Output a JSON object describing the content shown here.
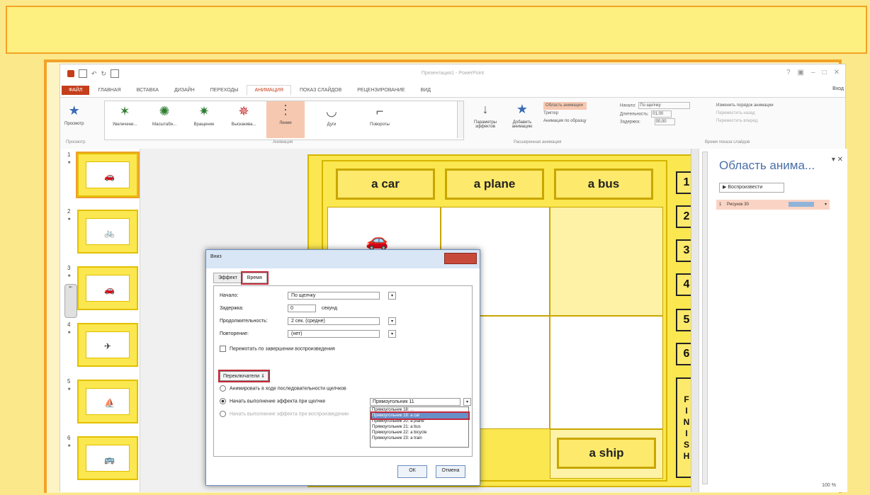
{
  "app": {
    "doc_title": "Презентация1 - PowerPoint",
    "user": "Вход"
  },
  "tabs": [
    "ФАЙЛ",
    "ГЛАВНАЯ",
    "ВСТАВКА",
    "ДИЗАЙН",
    "ПЕРЕХОДЫ",
    "АНИМАЦИЯ",
    "ПОКАЗ СЛАЙДОВ",
    "РЕЦЕНЗИРОВАНИЕ",
    "ВИД"
  ],
  "ribbon": {
    "preview_label": "Просмотр",
    "preview_group": "Просмотр",
    "animation_group": "Анимация",
    "animations": [
      {
        "label": "Увеличени..."
      },
      {
        "label": "Масштаби..."
      },
      {
        "label": "Вращение"
      },
      {
        "label": "Выскакива..."
      },
      {
        "label": "Линии"
      },
      {
        "label": "Дуги"
      },
      {
        "label": "Повороты"
      }
    ],
    "effect_params_label": "Параметры эффектов",
    "add_animation_label": "Добавить анимацию",
    "anim_pane_btn": "Область анимации",
    "trigger_btn": "Триггер",
    "anim_painter_btn": "Анимация по образцу",
    "ext_group": "Расширенная анимация",
    "start_label": "Начало:",
    "start_value": "По щелчку",
    "duration_label": "Длительность:",
    "duration_value": "01,00",
    "delay_label": "Задержка:",
    "delay_value": "00,00",
    "timing_group": "Время показа слайдов",
    "reorder_label": "Изменить порядок анимации",
    "move_earlier": "Переместить назад",
    "move_later": "Переместить вперед"
  },
  "thumbnails": [
    {
      "num": "1",
      "glyph": "🚗",
      "selected": true
    },
    {
      "num": "2",
      "glyph": "🚲",
      "selected": false
    },
    {
      "num": "3",
      "glyph": "🚗",
      "selected": false
    },
    {
      "num": "4",
      "glyph": "✈",
      "selected": false
    },
    {
      "num": "5",
      "glyph": "⛵",
      "selected": false
    },
    {
      "num": "6",
      "glyph": "🚌",
      "selected": false
    }
  ],
  "slide": {
    "labels": [
      "a car",
      "a plane",
      "a bus"
    ],
    "bottom_label": "a ship",
    "numbers": [
      "1",
      "2",
      "3",
      "4",
      "5",
      "6"
    ],
    "finish_letters": [
      "F",
      "I",
      "N",
      "I",
      "S",
      "H"
    ]
  },
  "anim_pane": {
    "title": "Область анима...",
    "play_btn": "Воспроизвести",
    "row_num": "1",
    "row_label": "Рисунок 30"
  },
  "dialog": {
    "title": "Вниз",
    "tab_effect": "Эффект",
    "tab_time": "Время",
    "start_label": "Начало:",
    "start_value": "По щелчку",
    "delay_label": "Задержка:",
    "delay_value": "0",
    "delay_unit": "секунд",
    "duration_label": "Продолжительность:",
    "duration_value": "2 сек. (средне)",
    "repeat_label": "Повторение:",
    "repeat_value": "(нет)",
    "rewind_label": "Перемотать по завершении воспроизведения",
    "triggers_btn": "Переключатели ⇓",
    "opt_sequence": "Анимировать в ходе последовательности щелчков",
    "opt_on_click": "Начать выполнение эффекта при щелчке",
    "opt_on_play": "Начать выполнение эффекта при воспроизведении",
    "trigger_selected": "Прямоугольник 11",
    "trigger_options": [
      "Прямоугольник 18: ...",
      "Прямоугольник 19: a car",
      "Прямоугольник 20: a plane",
      "Прямоугольник 21: a bus",
      "Прямоугольник 22: a bicycle",
      "Прямоугольник 23: a train"
    ],
    "ok": "ОК",
    "cancel": "Отмена"
  },
  "status": {
    "zoom": "100 %"
  },
  "colors": {
    "accent": "#c43e1c",
    "slide_yellow": "#fbe74f",
    "highlight_red": "#c4283a"
  }
}
